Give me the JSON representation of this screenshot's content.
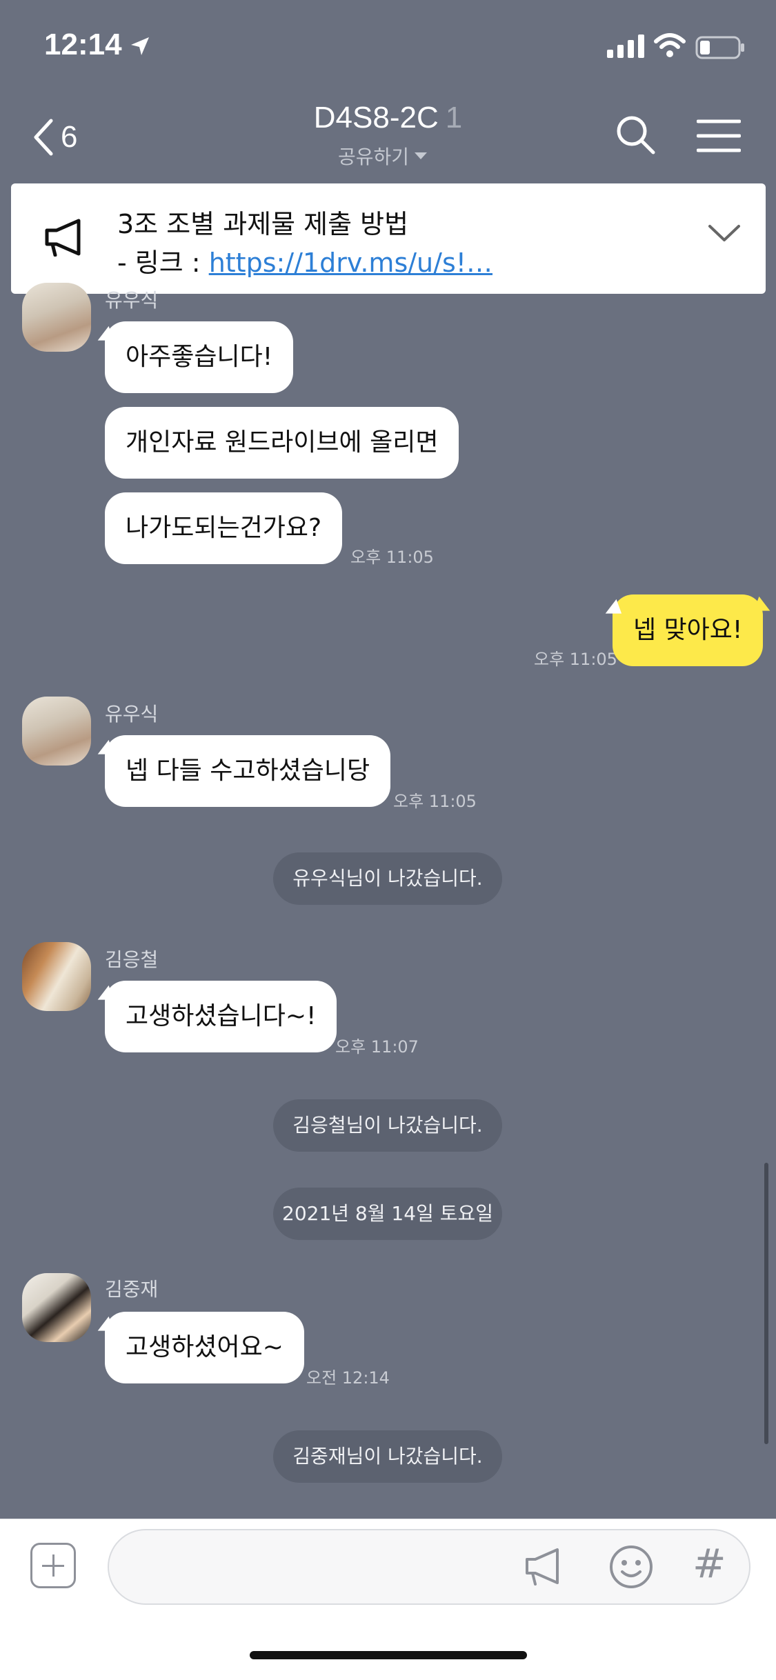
{
  "status_bar": {
    "time": "12:14"
  },
  "header": {
    "back_count": "6",
    "title": "D4S8-2C",
    "member_count": "1",
    "share_label": "공유하기"
  },
  "notice": {
    "title": "3조 조별 과제물 제출 방법",
    "link_prefix": "- 링크 : ",
    "link_text": "https://1drv.ms/u/s!…"
  },
  "messages": [
    {
      "sender": "유우식",
      "texts": [
        "아주좋습니다!",
        "개인자료 원드라이브에 올리면",
        "나가도되는건가요?"
      ],
      "time": "오후 11:05"
    },
    {
      "sender": "me",
      "texts": [
        "넵 맞아요!"
      ],
      "time": "오후 11:05"
    },
    {
      "sender": "유우식",
      "texts": [
        "넵 다들 수고하셨습니당"
      ],
      "time": "오후 11:05"
    },
    {
      "system": "유우식님이 나갔습니다."
    },
    {
      "sender": "김응철",
      "texts": [
        "고생하셨습니다~!"
      ],
      "time": "오후 11:07"
    },
    {
      "system": "김응철님이 나갔습니다."
    },
    {
      "system": "2021년 8월 14일 토요일"
    },
    {
      "sender": "김중재",
      "texts": [
        "고생하셨어요~"
      ],
      "time": "오전 12:14"
    },
    {
      "system": "김중재님이 나갔습니다."
    }
  ],
  "colors": {
    "background": "#6a707f",
    "my_bubble": "#fde94a",
    "other_bubble": "#ffffff",
    "link": "#2d7fd6"
  }
}
